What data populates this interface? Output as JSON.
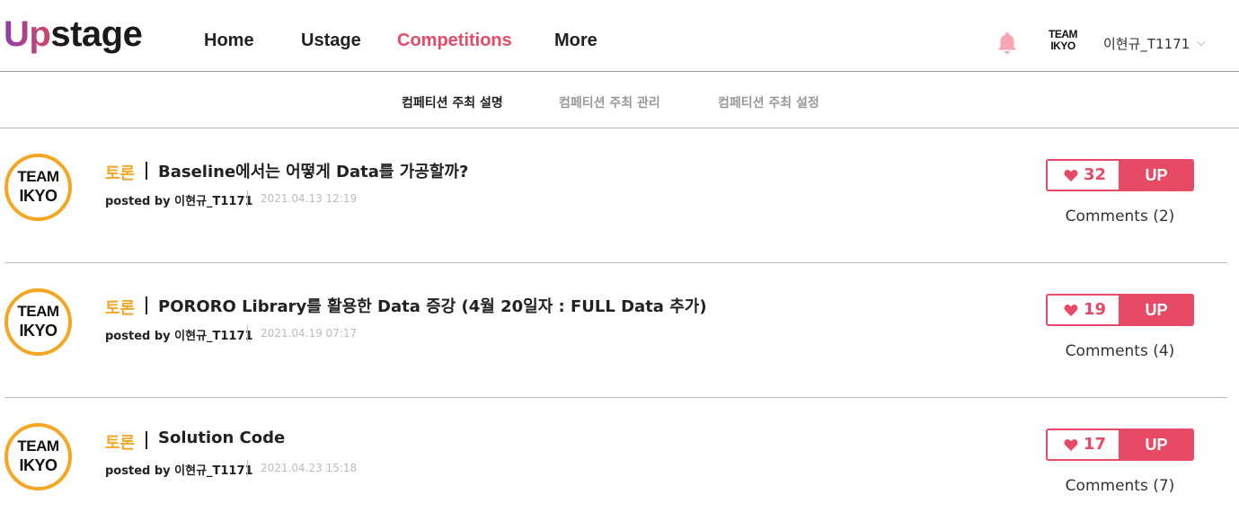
{
  "header": {
    "logo_up": "Up",
    "logo_rest": "stage",
    "nav": [
      "Home",
      "Ustage",
      "Competitions",
      "More"
    ],
    "active_nav": "Competitions",
    "team_line1": "TEAM",
    "team_line2": "IKYO",
    "user_name": "이현규_T1171",
    "user_caret": "⌵"
  },
  "subtabs": [
    "컴페티션 주최 설명",
    "컴페티션 주최 관리",
    "컴페티션 주최 설정"
  ],
  "colors": {
    "accent": "#e64a65",
    "category": "#f5a623",
    "avatar_border": "#f5a623"
  },
  "posts": [
    {
      "avatar_line1": "TEAM",
      "avatar_line2": "IKYO",
      "category": "토론",
      "title": "Baseline에서는 어떻게 Data를 가공할까?",
      "posted_by": "posted by 이현규_T1171",
      "date": "2021.04.13 12:19",
      "likes": "32",
      "up_label": "UP",
      "comments": "Comments (2)"
    },
    {
      "avatar_line1": "TEAM",
      "avatar_line2": "IKYO",
      "category": "토론",
      "title": "PORORO Library를 활용한 Data 증강 (4월 20일자 : FULL Data 추가)",
      "posted_by": "posted by 이현규_T1171",
      "date": "2021.04.19 07:17",
      "likes": "19",
      "up_label": "UP",
      "comments": "Comments (4)"
    },
    {
      "avatar_line1": "TEAM",
      "avatar_line2": "IKYO",
      "category": "토론",
      "title": "Solution Code",
      "posted_by": "posted by 이현규_T1171",
      "date": "2021.04.23 15:18",
      "likes": "17",
      "up_label": "UP",
      "comments": "Comments (7)"
    }
  ]
}
